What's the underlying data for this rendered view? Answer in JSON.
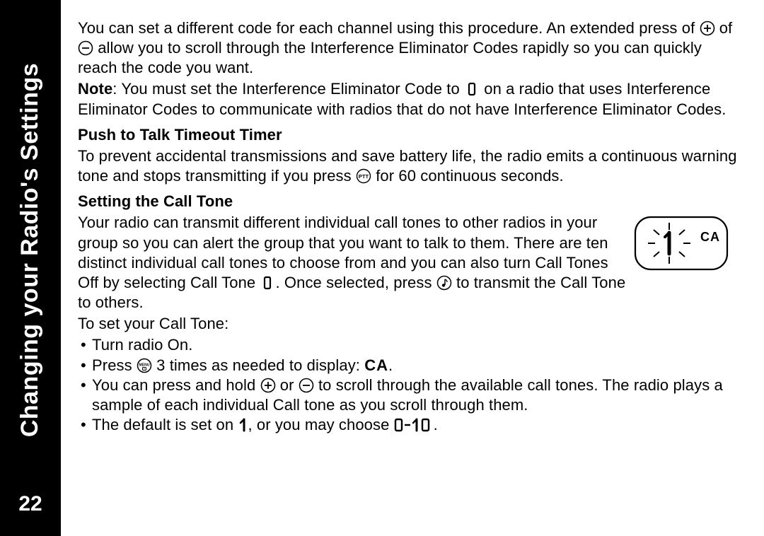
{
  "sidebar": {
    "title": "Changing your Radio's Settings",
    "page_number": "22"
  },
  "body": {
    "p1a": "You can set a different code for each channel using this procedure. An extended press of ",
    "p1b": " of ",
    "p1c": " allow you to scroll through the Interference Eliminator Codes rapidly so you can quickly reach the code you want.",
    "note_label": "Note",
    "note_a": ": You must set the Interference Eliminator Code to ",
    "note_b": " on a radio that uses Interference Eliminator Codes to communicate with radios that do not have Interference Eliminator Codes.",
    "h1": "Push to Talk Timeout Timer",
    "p2a": "To prevent accidental transmissions and save battery life, the radio emits a continuous warning tone and stops transmitting if you press ",
    "p2b": " for 60 continuous seconds.",
    "h2": "Setting the Call Tone",
    "p3a": "Your radio can transmit different individual call tones to other radios in your group so you can alert the group that you want to talk to them. There are ten distinct individual call tones to choose from and you can also turn Call Tones Off by selecting Call Tone ",
    "p3b": ". Once selected, press ",
    "p3c": " to transmit the Call Tone to others.",
    "p4": "To set your Call Tone:",
    "b1": "Turn radio On.",
    "b2a": "Press ",
    "b2b": " 3 times as needed to display: ",
    "b2c": ".",
    "b3a": "You can press and hold ",
    "b3b": " or ",
    "b3c": " to scroll through the available call tones. The radio plays a sample of each individual Call tone as you scroll through them.",
    "b4a": "The default is set on ",
    "b4b": ", or you may choose ",
    "b4c": "."
  },
  "icons": {
    "plus": "plus-circle-icon",
    "minus": "minus-circle-icon",
    "ptt": "ptt-icon",
    "music": "music-note-circle-icon",
    "menu": "menu-circle-icon"
  },
  "seg": {
    "zero": "0",
    "CA": "CA",
    "one": "1",
    "range": "0-10"
  },
  "display": {
    "CA": "CA"
  }
}
